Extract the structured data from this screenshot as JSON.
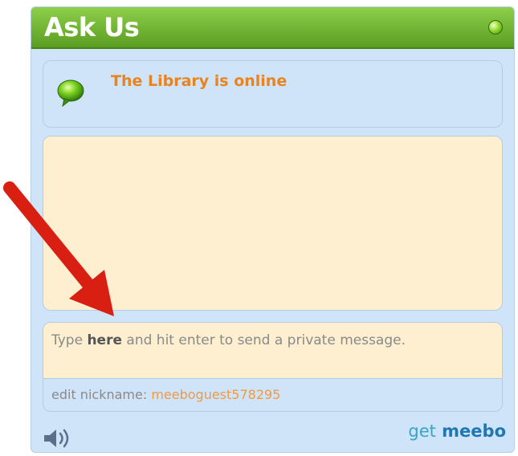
{
  "widget": {
    "title": "Ask Us",
    "status_text": "The Library is online"
  },
  "input": {
    "hint_prefix": "Type ",
    "hint_bold": "here",
    "hint_suffix": " and hit enter to send a private message."
  },
  "nickname": {
    "label": "edit nickname:",
    "value": "meeboguest578295"
  },
  "footer": {
    "sound_icon": "speaker-icon",
    "brand_get": "get",
    "brand_name": "meebo"
  },
  "colors": {
    "header_green": "#5a9d22",
    "status_orange": "#e8841f",
    "panel_blue": "#cfe4f8",
    "chat_bg": "#fdefd0",
    "arrow_red": "#d91f12"
  }
}
